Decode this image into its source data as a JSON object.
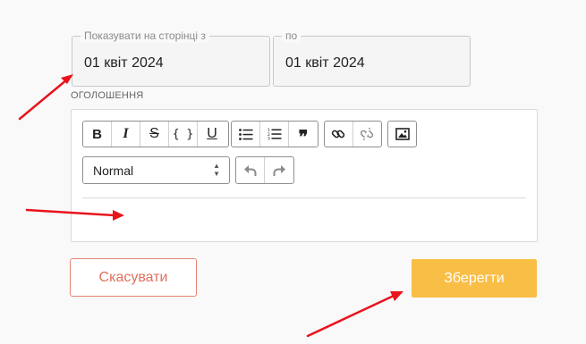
{
  "dates": {
    "from": {
      "legend": "Показувати на сторінці з",
      "value": "01 квіт 2024"
    },
    "to": {
      "legend": "по",
      "value": "01 квіт 2024"
    }
  },
  "announcement": {
    "label": "ОГОЛОШЕННЯ",
    "toolbar": {
      "bold": "B",
      "italic": "I",
      "strike": "S",
      "code": "{ }",
      "underline": "U",
      "bullet_list_icon": "bullet-list-icon",
      "ordered_list_icon": "ordered-list-icon",
      "quote_icon": "quote-icon",
      "link_icon": "link-icon",
      "unlink_icon": "unlink-icon",
      "image_icon": "image-icon",
      "undo_icon": "undo-icon",
      "redo_icon": "redo-icon"
    },
    "style_select": {
      "value": "Normal"
    }
  },
  "actions": {
    "cancel_label": "Скасувати",
    "save_label": "Зберегти"
  },
  "colors": {
    "save": "#f9be45",
    "cancel": "#e0705e",
    "annotation_arrows": "#e8141c"
  }
}
